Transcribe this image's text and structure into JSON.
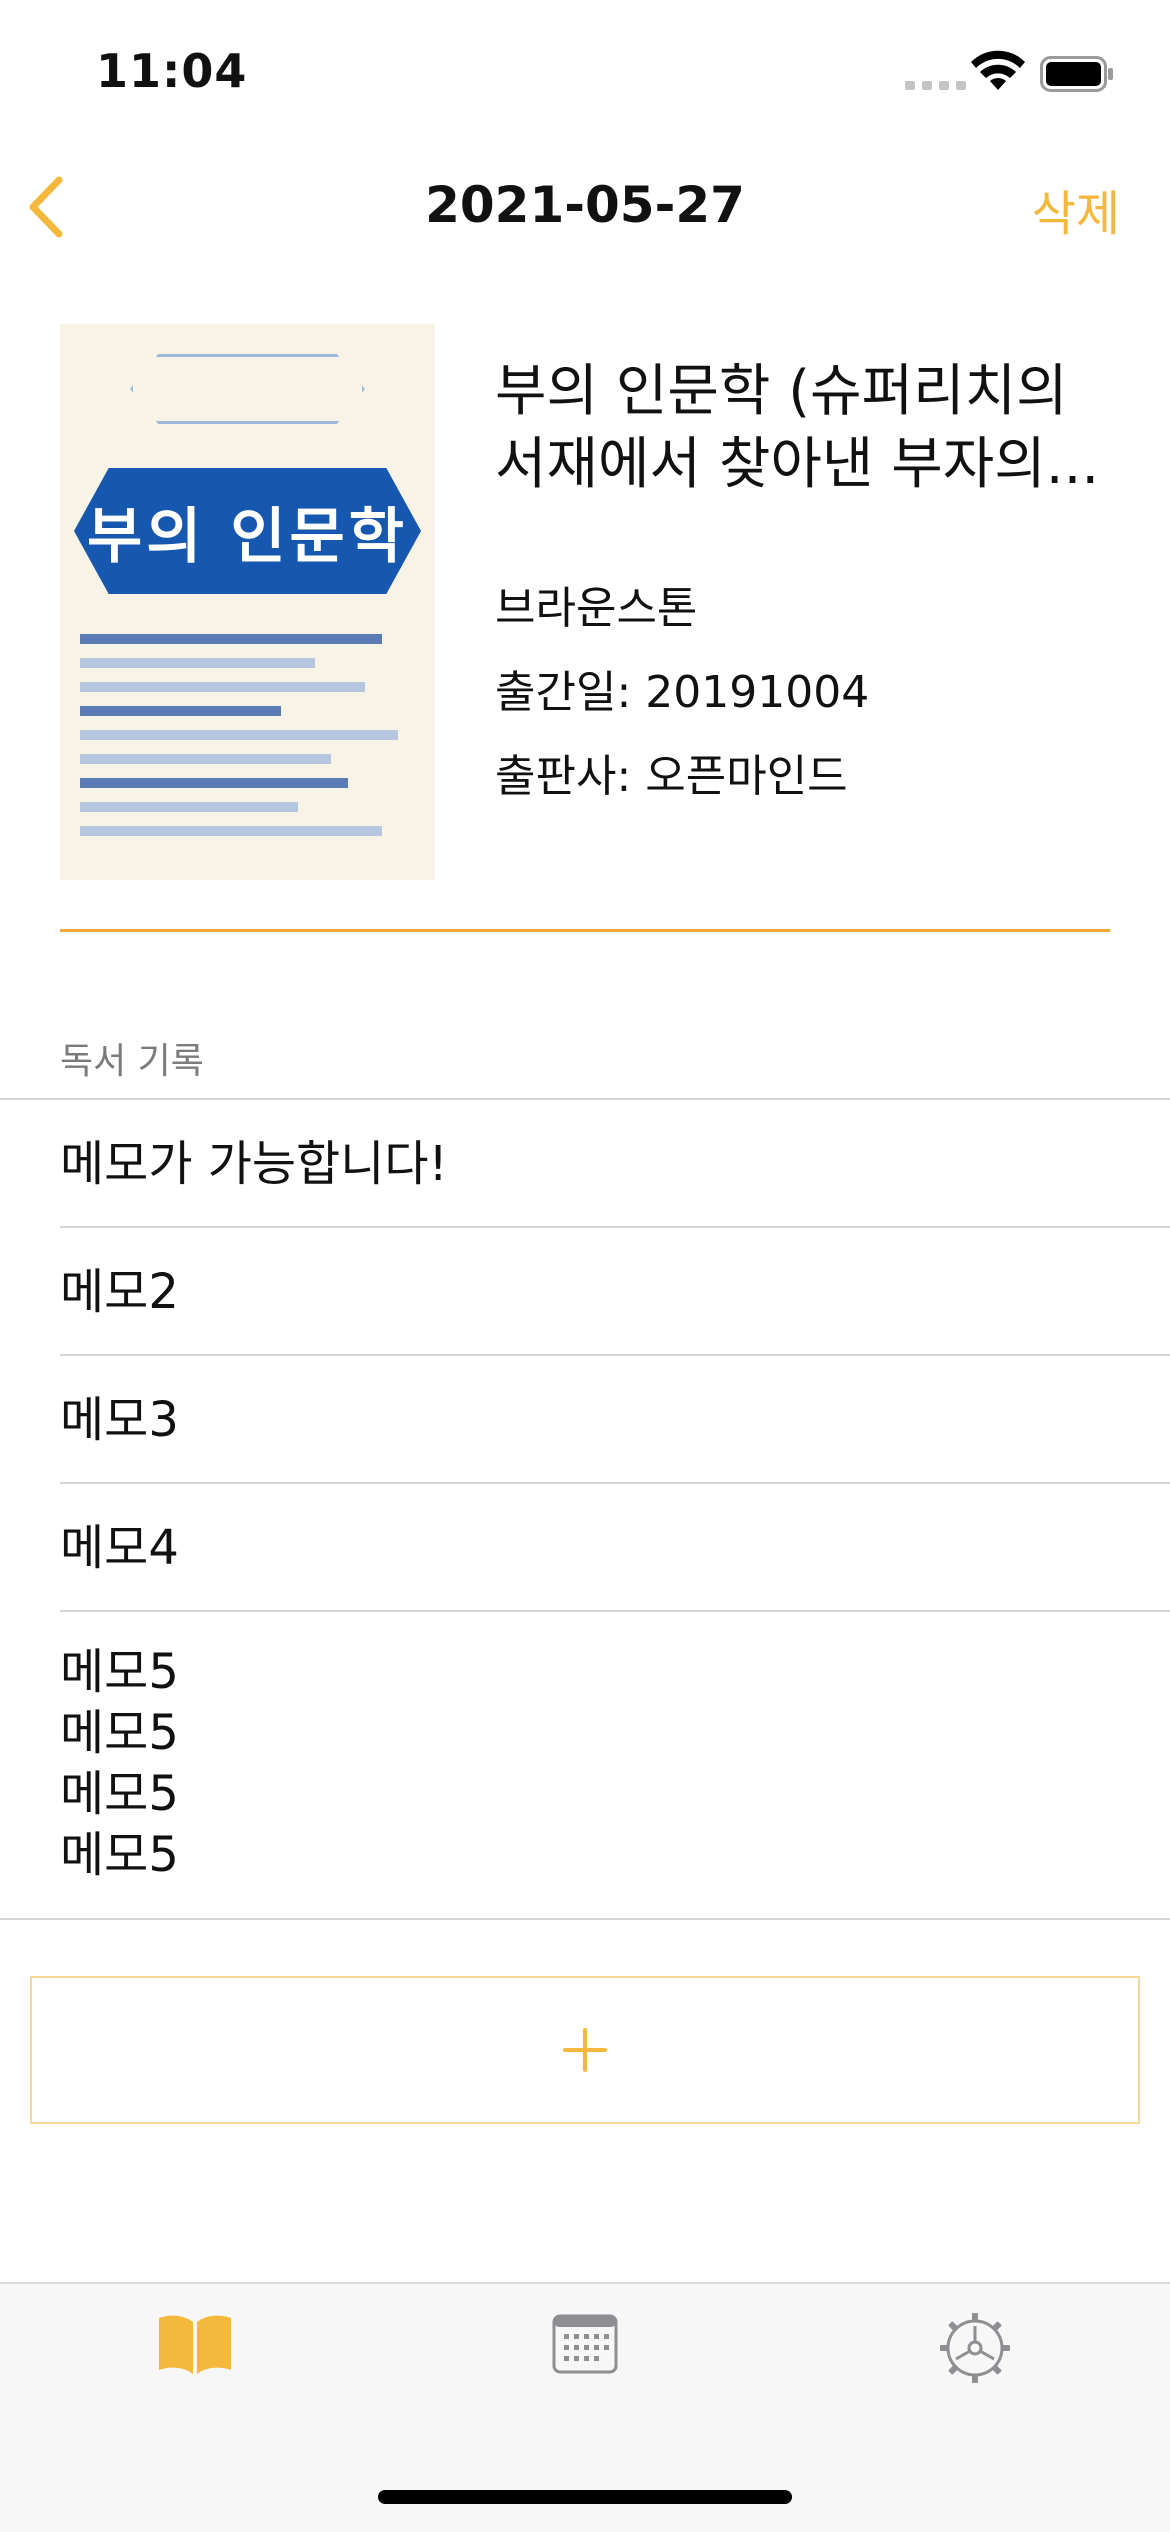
{
  "status_bar": {
    "time": "11:04"
  },
  "nav": {
    "title": "2021-05-27",
    "delete_label": "삭제",
    "back_icon": "chevron-left-icon"
  },
  "book": {
    "title": "부의 인문학 (슈퍼리치의 서재에서 찾아낸 부자의...",
    "author": "브라운스톤",
    "pub_date": "출간일: 20191004",
    "publisher": "출판사: 오픈마인드",
    "cover_title": "부의 인문학"
  },
  "records": {
    "header": "독서 기록",
    "items": [
      {
        "text": "메모가 가능합니다!"
      },
      {
        "text": "메모2"
      },
      {
        "text": "메모3"
      },
      {
        "text": "메모4"
      },
      {
        "text": "메모5\n메모5\n메모5\n메모5"
      }
    ]
  },
  "add_button": {
    "icon": "plus-icon"
  },
  "tab_bar": {
    "selected": "books",
    "tabs": [
      {
        "id": "books",
        "icon": "book-icon"
      },
      {
        "id": "calendar",
        "icon": "calendar-icon"
      },
      {
        "id": "settings",
        "icon": "gear-icon"
      }
    ]
  },
  "colors": {
    "accent": "#f4b83c",
    "divider": "#d6d6d6",
    "inactive_icon": "#8e8e93"
  }
}
